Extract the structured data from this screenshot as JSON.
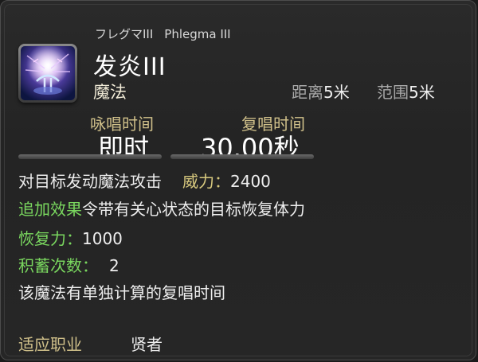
{
  "skill": {
    "name_jp": "フレグマIII",
    "name_en": "Phlegma III",
    "name": "发炎III",
    "category": "魔法",
    "distance_label": "距离",
    "distance_value": "5米",
    "range_label": "范围",
    "range_value": "5米",
    "icon": "phlegma-skill-icon"
  },
  "timing": {
    "cast_label": "咏唱时间",
    "cast_value": "即时",
    "recast_label": "复唱时间",
    "recast_value": "30.00秒"
  },
  "description": {
    "line1_text": "对目标发动魔法攻击",
    "potency_label": "威力：",
    "potency_value": "2400",
    "additional_label": "追加效果",
    "additional_text": "令带有关心状态的目标恢复体力",
    "cure_label": "恢复力：",
    "cure_value": "1000",
    "charges_label": "积蓄次数：",
    "charges_value": "2",
    "note": "该魔法有单独计算的复唱时间"
  },
  "footer": {
    "job_label": "适应职业",
    "job_value": "贤者"
  },
  "colors": {
    "effect_green": "#7ad85f",
    "label_gold": "#d0c08a",
    "text_white": "#eeeeee"
  }
}
